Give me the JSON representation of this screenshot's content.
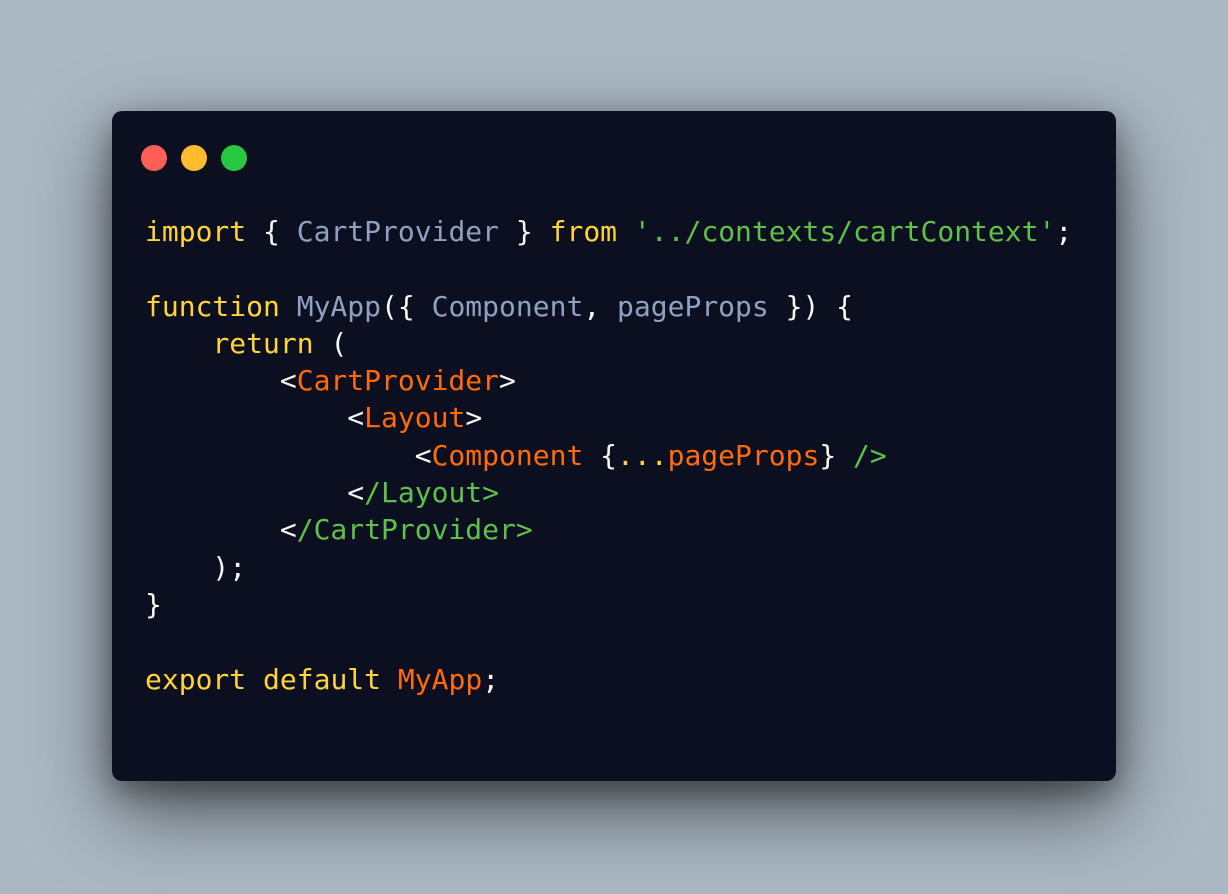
{
  "window": {
    "background": "#0c0f1f",
    "controls": [
      {
        "name": "close",
        "color": "#ff5f57"
      },
      {
        "name": "minimize",
        "color": "#febc2e"
      },
      {
        "name": "maximize",
        "color": "#28c840"
      }
    ]
  },
  "colors": {
    "keyword": "#ffd43b",
    "identifier": "#8fa1c2",
    "punctuation": "#f8f8f2",
    "string": "#5ec14a",
    "jsx_tag": "#ff6a0a",
    "spread": "#ffd43b"
  },
  "code": {
    "language": "javascript",
    "lines": [
      [
        {
          "text": "import",
          "kind": "keyword"
        },
        {
          "text": " { ",
          "kind": "punctuation"
        },
        {
          "text": "CartProvider",
          "kind": "identifier"
        },
        {
          "text": " } ",
          "kind": "punctuation"
        },
        {
          "text": "from",
          "kind": "keyword"
        },
        {
          "text": " ",
          "kind": "punctuation"
        },
        {
          "text": "'../contexts/cartContext'",
          "kind": "string"
        },
        {
          "text": ";",
          "kind": "punctuation"
        }
      ],
      [],
      [
        {
          "text": "function",
          "kind": "keyword"
        },
        {
          "text": " ",
          "kind": "punctuation"
        },
        {
          "text": "MyApp",
          "kind": "identifier"
        },
        {
          "text": "({ ",
          "kind": "punctuation"
        },
        {
          "text": "Component",
          "kind": "identifier"
        },
        {
          "text": ", ",
          "kind": "punctuation"
        },
        {
          "text": "pageProps",
          "kind": "identifier"
        },
        {
          "text": " }) {",
          "kind": "punctuation"
        }
      ],
      [
        {
          "text": "    ",
          "kind": "punctuation"
        },
        {
          "text": "return",
          "kind": "keyword"
        },
        {
          "text": " (",
          "kind": "punctuation"
        }
      ],
      [
        {
          "text": "        <",
          "kind": "punctuation"
        },
        {
          "text": "CartProvider",
          "kind": "jsx_tag"
        },
        {
          "text": ">",
          "kind": "punctuation"
        }
      ],
      [
        {
          "text": "            <",
          "kind": "punctuation"
        },
        {
          "text": "Layout",
          "kind": "jsx_tag"
        },
        {
          "text": ">",
          "kind": "punctuation"
        }
      ],
      [
        {
          "text": "                <",
          "kind": "punctuation"
        },
        {
          "text": "Component",
          "kind": "jsx_tag"
        },
        {
          "text": " {",
          "kind": "punctuation"
        },
        {
          "text": "...",
          "kind": "spread"
        },
        {
          "text": "pageProps",
          "kind": "jsx_tag"
        },
        {
          "text": "} ",
          "kind": "punctuation"
        },
        {
          "text": "/>",
          "kind": "string"
        }
      ],
      [
        {
          "text": "            <",
          "kind": "punctuation"
        },
        {
          "text": "/Layout>",
          "kind": "string"
        }
      ],
      [
        {
          "text": "        <",
          "kind": "punctuation"
        },
        {
          "text": "/CartProvider>",
          "kind": "string"
        }
      ],
      [
        {
          "text": "    );",
          "kind": "punctuation"
        }
      ],
      [
        {
          "text": "}",
          "kind": "punctuation"
        }
      ],
      [],
      [
        {
          "text": "export",
          "kind": "keyword"
        },
        {
          "text": " ",
          "kind": "punctuation"
        },
        {
          "text": "default",
          "kind": "keyword"
        },
        {
          "text": " ",
          "kind": "punctuation"
        },
        {
          "text": "MyApp",
          "kind": "jsx_tag"
        },
        {
          "text": ";",
          "kind": "punctuation"
        }
      ]
    ]
  }
}
